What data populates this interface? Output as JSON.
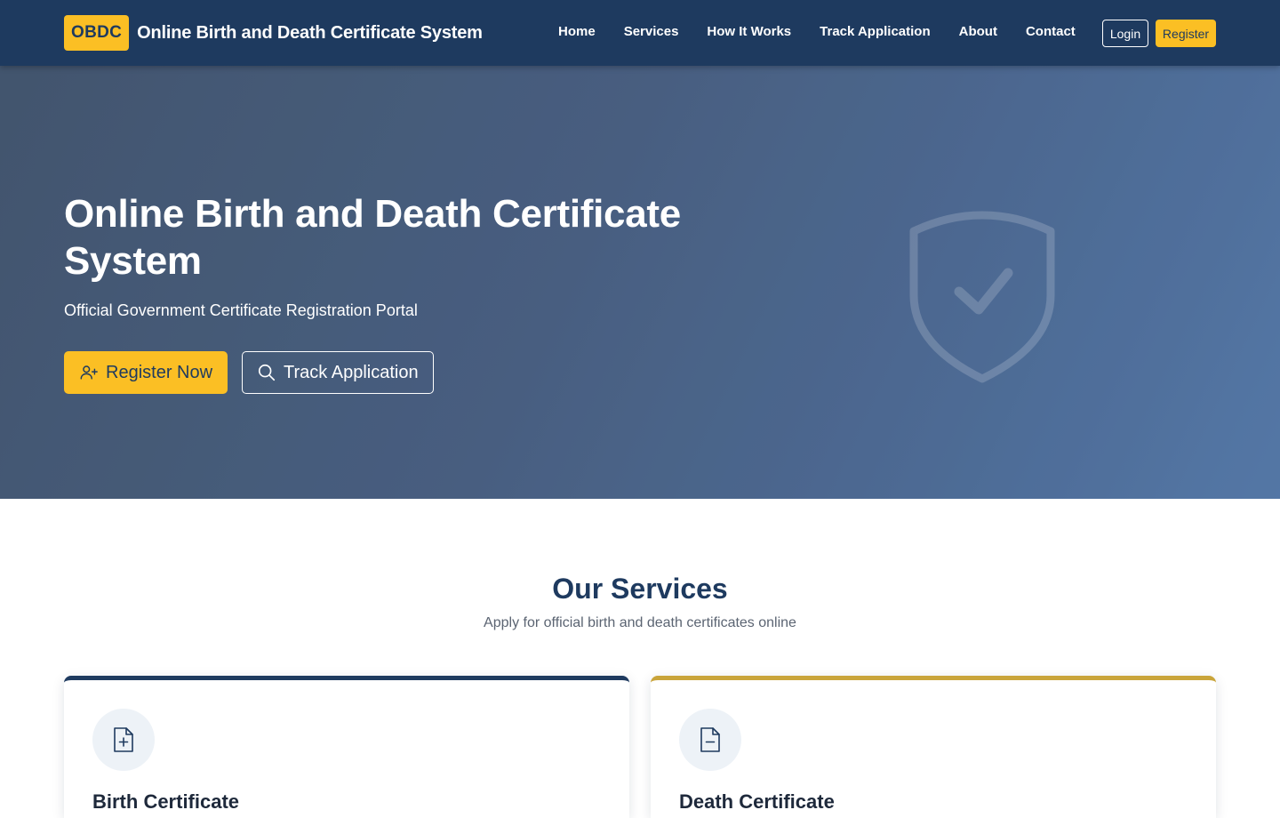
{
  "brand": {
    "badge": "OBDC",
    "name": "Online Birth and Death Certificate System"
  },
  "nav": {
    "links": [
      "Home",
      "Services",
      "How It Works",
      "Track Application",
      "About",
      "Contact"
    ],
    "login": "Login",
    "register": "Register"
  },
  "hero": {
    "title": "Online Birth and Death Certificate System",
    "subtitle": "Official Government Certificate Registration Portal",
    "primary_button": {
      "label": "Register Now",
      "icon": "user-plus-icon"
    },
    "secondary_button": {
      "label": "Track Application",
      "icon": "search-icon"
    },
    "decoration_icon": "shield-check-icon"
  },
  "services": {
    "title": "Our Services",
    "subtitle": "Apply for official birth and death certificates online",
    "cards": [
      {
        "title": "Birth Certificate",
        "icon": "file-plus-icon",
        "accent": "#1e3a5f"
      },
      {
        "title": "Death Certificate",
        "icon": "file-minus-icon",
        "accent": "#c9a43a"
      }
    ]
  },
  "colors": {
    "primary": "#1e3a5f",
    "accent": "#fbbf24",
    "gold": "#c9a43a",
    "white": "#ffffff"
  }
}
